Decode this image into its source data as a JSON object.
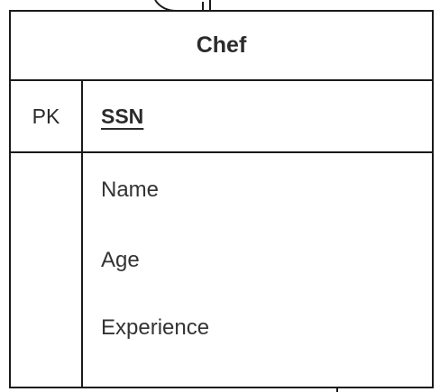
{
  "entity": {
    "name": "Chef",
    "primary_key": {
      "label": "PK",
      "attribute": "SSN"
    },
    "attributes": [
      "Name",
      "Age",
      "Experience"
    ]
  }
}
